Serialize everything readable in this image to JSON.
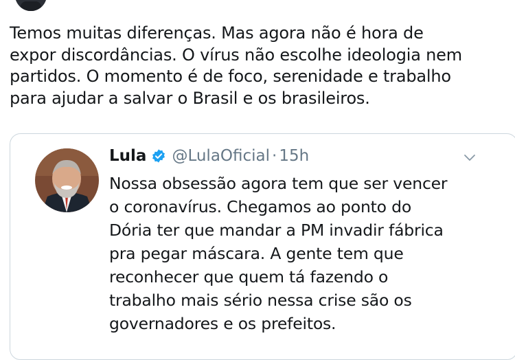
{
  "main_tweet": {
    "lines": [
      "Temos muitas diferenças. Mas agora não é hora de",
      "expor discordâncias. O vírus não escolhe ideologia nem",
      "partidos. O momento é de foco, serenidade e trabalho",
      "para ajudar a salvar o Brasil e os brasileiros."
    ]
  },
  "quoted_tweet": {
    "name": "Lula",
    "handle": "@LulaOficial",
    "separator": "·",
    "time": "15h",
    "verified_icon": "verified-badge-icon",
    "menu_icon": "chevron-down-icon",
    "accent_color": "#1da1f2",
    "lines": [
      "Nossa obsessão agora tem que ser vencer",
      "o coronavírus. Chegamos ao ponto do",
      "Dória ter que mandar a PM invadir fábrica",
      "pra pegar máscara. A gente tem que",
      "reconhecer que quem tá fazendo o",
      "trabalho mais sério nessa crise são os",
      "governadores e os prefeitos."
    ]
  }
}
